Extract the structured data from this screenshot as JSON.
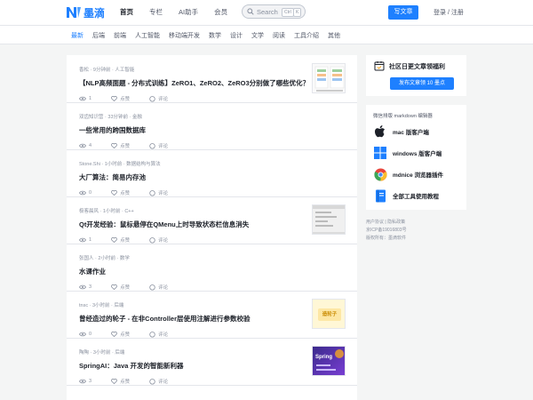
{
  "header": {
    "logo_text": "墨滴",
    "nav": [
      {
        "label": "首页",
        "active": true
      },
      {
        "label": "专栏",
        "active": false
      },
      {
        "label": "AI助手",
        "active": false
      },
      {
        "label": "会员",
        "active": false
      }
    ],
    "search_placeholder": "Search",
    "search_kbd": [
      "Ctrl",
      "K"
    ],
    "write_label": "写文章",
    "login_label": "登录 / 注册"
  },
  "categories": [
    {
      "label": "最新",
      "active": true
    },
    {
      "label": "后端",
      "active": false
    },
    {
      "label": "前端",
      "active": false
    },
    {
      "label": "人工智能",
      "active": false
    },
    {
      "label": "移动端开发",
      "active": false
    },
    {
      "label": "数学",
      "active": false
    },
    {
      "label": "设计",
      "active": false
    },
    {
      "label": "文学",
      "active": false
    },
    {
      "label": "阅读",
      "active": false
    },
    {
      "label": "工具介绍",
      "active": false
    },
    {
      "label": "其他",
      "active": false
    }
  ],
  "feed": [
    {
      "meta": "香松 · 9分钟前 · 人工智能",
      "title": "【NLP高频面题 - 分布式训练】ZeRO1、ZeRO2、ZeRO3分别做了哪些优化？",
      "views": "1",
      "like_label": "点赞",
      "comment_label": "评论",
      "thumb": "chart"
    },
    {
      "meta": "双齿知识营 · 33分钟前 · 金融",
      "title": "一些常用的跨国数据库",
      "views": "4",
      "like_label": "点赞",
      "comment_label": "评论",
      "thumb": ""
    },
    {
      "meta": "Stone.Shi · 1小时前 · 数据结构与算法",
      "title": "大厂算法：简易内存池",
      "views": "0",
      "like_label": "点赞",
      "comment_label": "评论",
      "thumb": ""
    },
    {
      "meta": "极客晨风 · 1小时前 · C++",
      "title": "Qt开发经验：鼠标悬停在QMenu上时导致状态栏信息消失",
      "views": "1",
      "like_label": "点赞",
      "comment_label": "评论",
      "thumb": "screen"
    },
    {
      "meta": "张国人 · 2小时前 · 数学",
      "title": "水课作业",
      "views": "3",
      "like_label": "点赞",
      "comment_label": "评论",
      "thumb": ""
    },
    {
      "meta": "tnsc · 3小时前 · 后端",
      "title": "曾经造过的轮子 - 在非Controller层使用注解进行参数校验",
      "views": "0",
      "like_label": "点赞",
      "comment_label": "评论",
      "thumb": "yellow"
    },
    {
      "meta": "陶陶 · 3小时前 · 后端",
      "title": "SpringAI：Java 开发的智能新利器",
      "views": "3",
      "like_label": "点赞",
      "comment_label": "评论",
      "thumb": "spring"
    }
  ],
  "thumb_text": {
    "yellow": "造轮子",
    "spring": "Spring"
  },
  "signin": {
    "title": "社区日更文章领福利",
    "button": "发布文章领 10 墨点"
  },
  "tools": {
    "heading": "微信排版 markdown 编辑器",
    "items": [
      {
        "label": "mac 版客户端",
        "icon": "apple-icon"
      },
      {
        "label": "windows 版客户端",
        "icon": "windows-icon"
      },
      {
        "label": "mdnice 浏览器插件",
        "icon": "chrome-icon"
      },
      {
        "label": "全部工具使用教程",
        "icon": "book-icon"
      }
    ]
  },
  "footer": [
    "用户协议 | 隐私政策",
    "京ICP备19016803号",
    "版权所有：墨滴软件"
  ],
  "colors": {
    "accent": "#1e80ff",
    "text": "#1d2129",
    "muted": "#8a919f"
  }
}
